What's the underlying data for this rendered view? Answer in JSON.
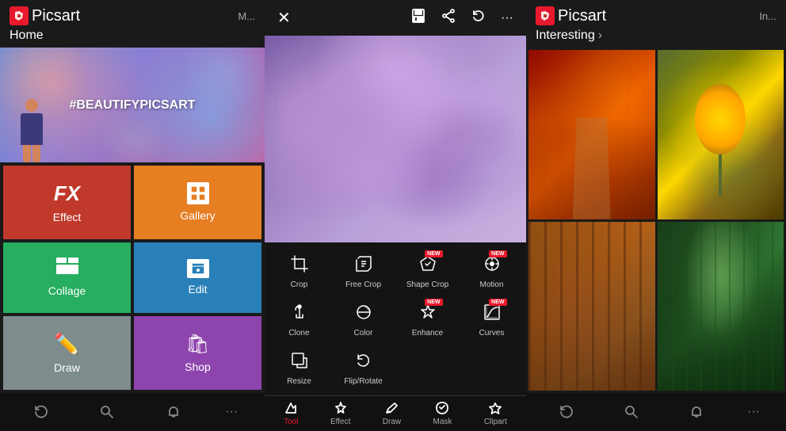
{
  "panel1": {
    "logo": "Picsart",
    "nav": "Home",
    "nav_right": "M...",
    "hero_text": "#BEAUTIFYPICSART",
    "tiles": [
      {
        "id": "effect",
        "label": "Effect",
        "color": "#c0392b"
      },
      {
        "id": "gallery",
        "label": "Gallery",
        "color": "#e67e22"
      },
      {
        "id": "collage",
        "label": "Collage",
        "color": "#27ae60"
      },
      {
        "id": "edit",
        "label": "Edit",
        "color": "#2980b9"
      },
      {
        "id": "draw",
        "label": "Draw",
        "color": "#7f8c8d"
      },
      {
        "id": "shop",
        "label": "Shop",
        "color": "#8e44ad"
      }
    ],
    "bottom_nav": [
      "refresh",
      "search",
      "bell",
      "dots"
    ]
  },
  "panel2": {
    "header_icons": [
      "close",
      "save",
      "share",
      "undo",
      "more"
    ],
    "tools": [
      {
        "id": "crop",
        "label": "Crop",
        "new": false
      },
      {
        "id": "free-crop",
        "label": "Free Crop",
        "new": false
      },
      {
        "id": "shape-crop",
        "label": "Shape Crop",
        "new": true
      },
      {
        "id": "motion",
        "label": "Motion",
        "new": true
      },
      {
        "id": "clone",
        "label": "Clone",
        "new": false
      },
      {
        "id": "color",
        "label": "Color",
        "new": false
      },
      {
        "id": "enhance",
        "label": "Enhance",
        "new": true
      },
      {
        "id": "curves",
        "label": "Curves",
        "new": true
      },
      {
        "id": "resize",
        "label": "Resize",
        "new": false
      },
      {
        "id": "flip-rotate",
        "label": "Flip/Rotate",
        "new": false
      }
    ],
    "bottom_tools": [
      {
        "id": "tool",
        "label": "Tool",
        "active": true
      },
      {
        "id": "effect",
        "label": "Effect",
        "active": false
      },
      {
        "id": "draw",
        "label": "Draw",
        "active": false
      },
      {
        "id": "mask",
        "label": "Mask",
        "active": false
      },
      {
        "id": "clipart",
        "label": "Clipart",
        "active": false
      }
    ]
  },
  "panel3": {
    "logo": "Picsart",
    "section_title": "Interesting",
    "section_arrow": "›",
    "nav_right": "In...",
    "bottom_nav": [
      "refresh",
      "search",
      "bell",
      "dots"
    ],
    "images": [
      {
        "id": "autumn-path",
        "desc": "Red autumn forest path"
      },
      {
        "id": "sunflower",
        "desc": "Sunflower digital art"
      },
      {
        "id": "warm-forest",
        "desc": "Warm golden forest"
      },
      {
        "id": "green-forest",
        "desc": "Dark green forest with light"
      }
    ]
  }
}
